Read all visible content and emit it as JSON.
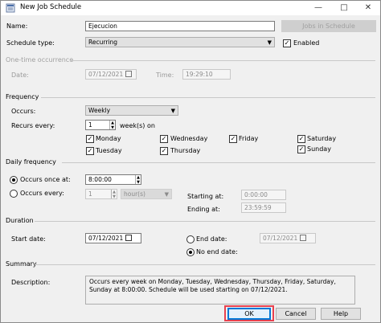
{
  "window": {
    "title": "New Job Schedule",
    "minimize_glyph": "—",
    "maximize_glyph": "□",
    "close_glyph": "✕"
  },
  "name": {
    "label": "Name:",
    "value": "Ejecucion",
    "jobs_button": "Jobs in Schedule"
  },
  "schedule_type": {
    "label": "Schedule type:",
    "value": "Recurring",
    "enabled_label": "Enabled"
  },
  "one_time": {
    "section": "One-time occurrence",
    "date_label": "Date:",
    "date_value": "07/12/2021",
    "time_label": "Time:",
    "time_value": "19:29:10"
  },
  "frequency": {
    "section": "Frequency",
    "occurs_label": "Occurs:",
    "occurs_value": "Weekly",
    "recurs_label": "Recurs every:",
    "recurs_value": "1",
    "recurs_suffix": "week(s) on",
    "days": {
      "monday": "Monday",
      "tuesday": "Tuesday",
      "wednesday": "Wednesday",
      "thursday": "Thursday",
      "friday": "Friday",
      "saturday": "Saturday",
      "sunday": "Sunday"
    }
  },
  "daily": {
    "section": "Daily frequency",
    "once_label": "Occurs once at:",
    "once_value": "8:00:00",
    "every_label": "Occurs every:",
    "every_value": "1",
    "every_unit": "hour(s)",
    "starting_label": "Starting at:",
    "starting_value": "0:00:00",
    "ending_label": "Ending at:",
    "ending_value": "23:59:59"
  },
  "duration": {
    "section": "Duration",
    "start_label": "Start date:",
    "start_value": "07/12/2021",
    "end_label": "End date:",
    "end_value": "07/12/2021",
    "no_end_label": "No end date:"
  },
  "summary": {
    "section": "Summary",
    "description_label": "Description:",
    "description_text": "Occurs every week on Monday, Tuesday, Wednesday, Thursday, Friday, Saturday, Sunday at 8:00:00. Schedule will be used starting on 07/12/2021."
  },
  "buttons": {
    "ok": "OK",
    "cancel": "Cancel",
    "help": "Help"
  }
}
